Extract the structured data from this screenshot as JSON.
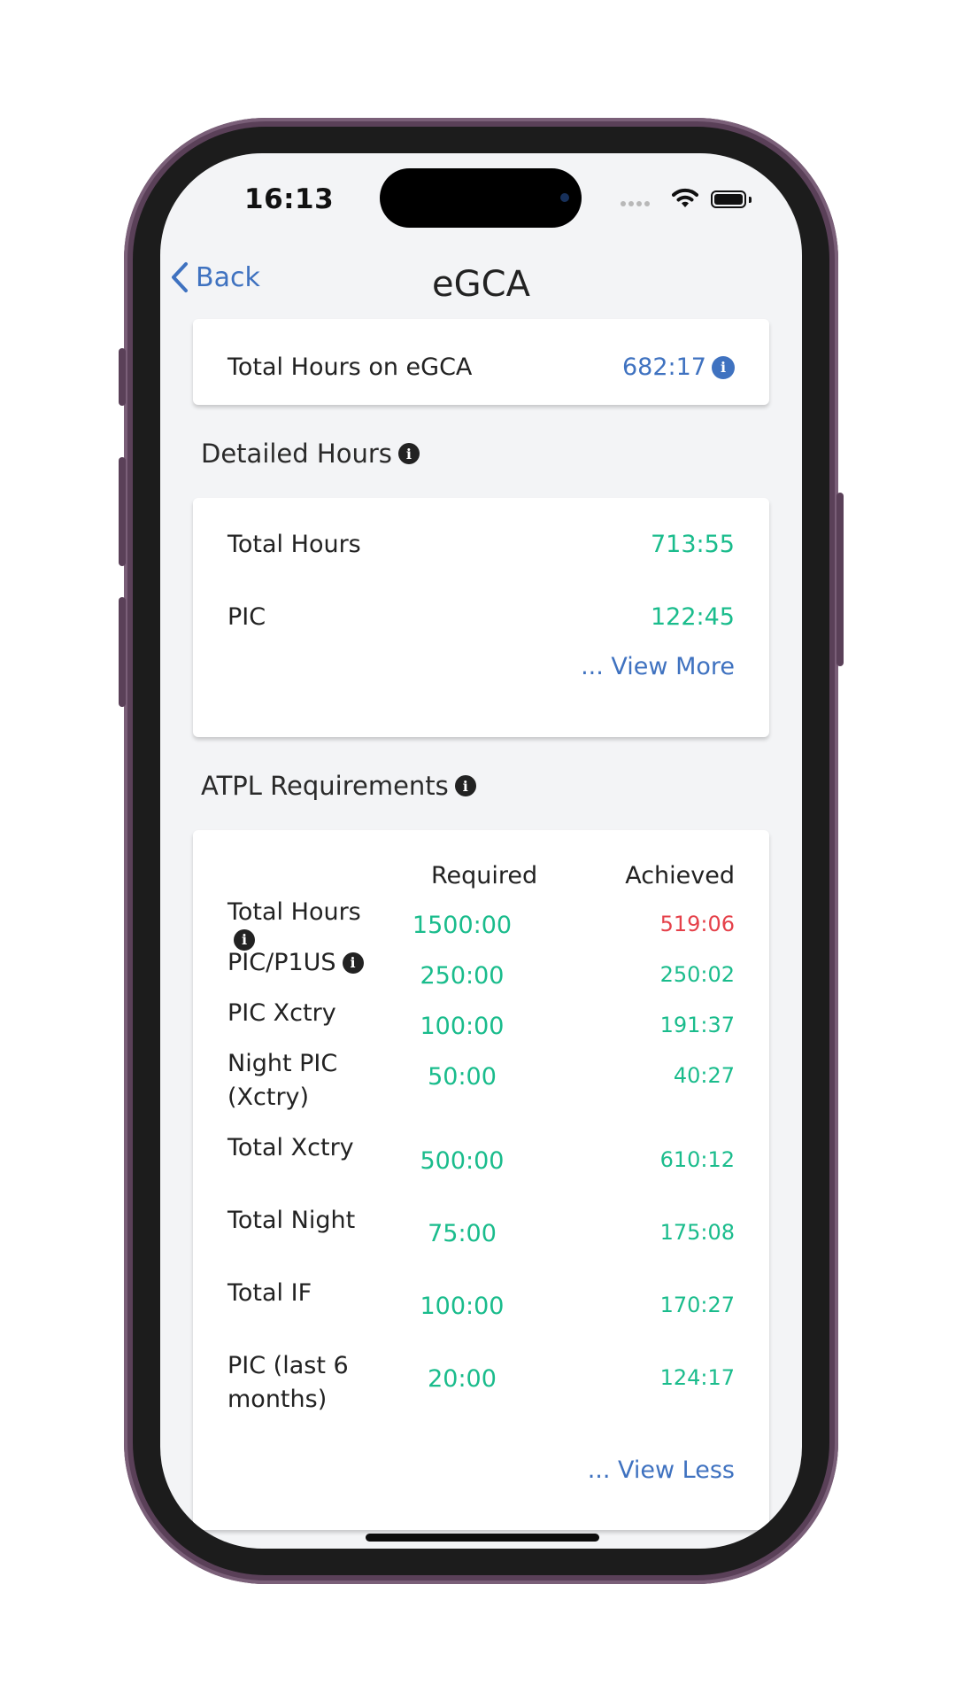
{
  "status_bar": {
    "time": "16:13"
  },
  "nav": {
    "back_label": "Back",
    "title": "eGCA"
  },
  "egca_total": {
    "label": "Total Hours on eGCA",
    "value": "682:17"
  },
  "detailed": {
    "title": "Detailed Hours",
    "rows": [
      {
        "label": "Total Hours",
        "value": "713:55"
      },
      {
        "label": "PIC",
        "value": "122:45"
      }
    ],
    "view_more": "... View More"
  },
  "atpl": {
    "title": "ATPL Requirements",
    "col_required": "Required",
    "col_achieved": "Achieved",
    "rows": [
      {
        "label": "Total Hours",
        "required": "1500:00",
        "achieved": "519:06",
        "status": "short"
      },
      {
        "label": "PIC/P1US",
        "required": "250:00",
        "achieved": "250:02",
        "status": "met"
      },
      {
        "label": "PIC Xctry",
        "required": "100:00",
        "achieved": "191:37",
        "status": "met"
      },
      {
        "label": "Night PIC (Xctry)",
        "required": "50:00",
        "achieved": "40:27",
        "status": "met"
      },
      {
        "label": "Total Xctry",
        "required": "500:00",
        "achieved": "610:12",
        "status": "met"
      },
      {
        "label": "Total Night",
        "required": "75:00",
        "achieved": "175:08",
        "status": "met"
      },
      {
        "label": "Total IF",
        "required": "100:00",
        "achieved": "170:27",
        "status": "met"
      },
      {
        "label": "PIC (last 6 months)",
        "required": "20:00",
        "achieved": "124:17",
        "status": "met"
      }
    ],
    "view_less": "... View Less"
  },
  "colors": {
    "accent_blue": "#3f72c0",
    "green": "#1abc8c",
    "red": "#e5414a"
  },
  "icons": [
    "chevron-left-icon",
    "info-icon",
    "wifi-icon",
    "battery-icon"
  ]
}
